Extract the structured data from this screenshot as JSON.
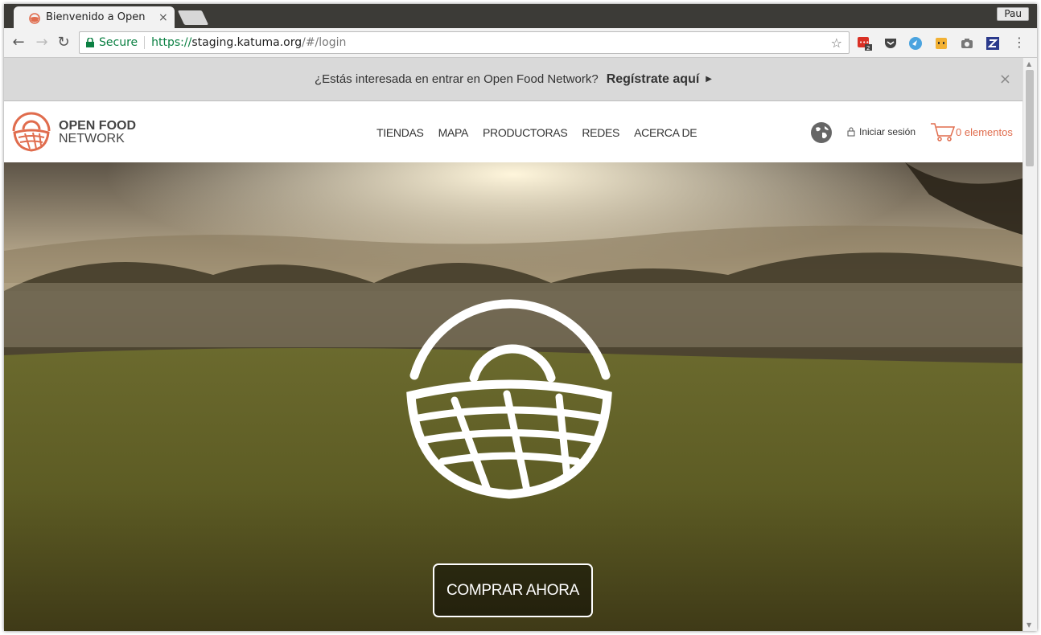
{
  "browser": {
    "tab_title": "Bienvenido a Open",
    "tab_close": "×",
    "profile_name": "Pau",
    "secure_label": "Secure",
    "url_protocol": "https://",
    "url_host": "staging.katuma.org",
    "url_path": "/#/login",
    "ext_badge": "2"
  },
  "banner": {
    "text": "¿Estás interesada en entrar en Open Food Network?",
    "link": "Regístrate aquí",
    "close": "×"
  },
  "header": {
    "logo_line1": "OPEN FOOD",
    "logo_line2": "NETWORK",
    "menu": [
      "TIENDAS",
      "MAPA",
      "PRODUCTORAS",
      "REDES",
      "ACERCA DE"
    ],
    "login": "Iniciar sesión",
    "cart": "0 elementos"
  },
  "hero": {
    "cta": "COMPRAR AHORA"
  },
  "colors": {
    "brand_orange": "#e06c4d",
    "secure_green": "#0b8043"
  }
}
